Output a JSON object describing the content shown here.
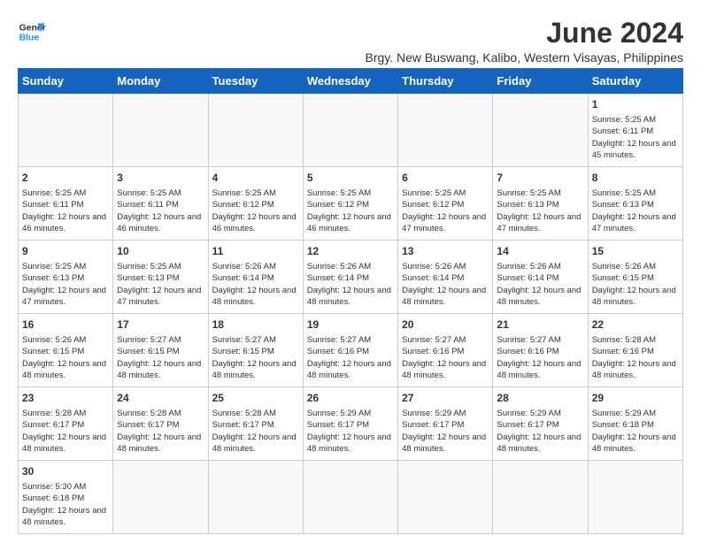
{
  "logo": {
    "line1": "General",
    "line2": "Blue"
  },
  "title": "June 2024",
  "subtitle": "Brgy. New Buswang, Kalibo, Western Visayas, Philippines",
  "days_of_week": [
    "Sunday",
    "Monday",
    "Tuesday",
    "Wednesday",
    "Thursday",
    "Friday",
    "Saturday"
  ],
  "weeks": [
    [
      {
        "day": "",
        "empty": true
      },
      {
        "day": "",
        "empty": true
      },
      {
        "day": "",
        "empty": true
      },
      {
        "day": "",
        "empty": true
      },
      {
        "day": "",
        "empty": true
      },
      {
        "day": "",
        "empty": true
      },
      {
        "day": "1",
        "sunrise": "5:25 AM",
        "sunset": "6:11 PM",
        "daylight": "12 hours and 45 minutes."
      }
    ],
    [
      {
        "day": "2",
        "sunrise": "5:25 AM",
        "sunset": "6:11 PM",
        "daylight": "12 hours and 46 minutes."
      },
      {
        "day": "3",
        "sunrise": "5:25 AM",
        "sunset": "6:11 PM",
        "daylight": "12 hours and 46 minutes."
      },
      {
        "day": "4",
        "sunrise": "5:25 AM",
        "sunset": "6:12 PM",
        "daylight": "12 hours and 46 minutes."
      },
      {
        "day": "5",
        "sunrise": "5:25 AM",
        "sunset": "6:12 PM",
        "daylight": "12 hours and 46 minutes."
      },
      {
        "day": "6",
        "sunrise": "5:25 AM",
        "sunset": "6:12 PM",
        "daylight": "12 hours and 47 minutes."
      },
      {
        "day": "7",
        "sunrise": "5:25 AM",
        "sunset": "6:13 PM",
        "daylight": "12 hours and 47 minutes."
      },
      {
        "day": "8",
        "sunrise": "5:25 AM",
        "sunset": "6:13 PM",
        "daylight": "12 hours and 47 minutes."
      }
    ],
    [
      {
        "day": "9",
        "sunrise": "5:25 AM",
        "sunset": "6:13 PM",
        "daylight": "12 hours and 47 minutes."
      },
      {
        "day": "10",
        "sunrise": "5:25 AM",
        "sunset": "6:13 PM",
        "daylight": "12 hours and 47 minutes."
      },
      {
        "day": "11",
        "sunrise": "5:26 AM",
        "sunset": "6:14 PM",
        "daylight": "12 hours and 48 minutes."
      },
      {
        "day": "12",
        "sunrise": "5:26 AM",
        "sunset": "6:14 PM",
        "daylight": "12 hours and 48 minutes."
      },
      {
        "day": "13",
        "sunrise": "5:26 AM",
        "sunset": "6:14 PM",
        "daylight": "12 hours and 48 minutes."
      },
      {
        "day": "14",
        "sunrise": "5:26 AM",
        "sunset": "6:14 PM",
        "daylight": "12 hours and 48 minutes."
      },
      {
        "day": "15",
        "sunrise": "5:26 AM",
        "sunset": "6:15 PM",
        "daylight": "12 hours and 48 minutes."
      }
    ],
    [
      {
        "day": "16",
        "sunrise": "5:26 AM",
        "sunset": "6:15 PM",
        "daylight": "12 hours and 48 minutes."
      },
      {
        "day": "17",
        "sunrise": "5:27 AM",
        "sunset": "6:15 PM",
        "daylight": "12 hours and 48 minutes."
      },
      {
        "day": "18",
        "sunrise": "5:27 AM",
        "sunset": "6:15 PM",
        "daylight": "12 hours and 48 minutes."
      },
      {
        "day": "19",
        "sunrise": "5:27 AM",
        "sunset": "6:16 PM",
        "daylight": "12 hours and 48 minutes."
      },
      {
        "day": "20",
        "sunrise": "5:27 AM",
        "sunset": "6:16 PM",
        "daylight": "12 hours and 48 minutes."
      },
      {
        "day": "21",
        "sunrise": "5:27 AM",
        "sunset": "6:16 PM",
        "daylight": "12 hours and 48 minutes."
      },
      {
        "day": "22",
        "sunrise": "5:28 AM",
        "sunset": "6:16 PM",
        "daylight": "12 hours and 48 minutes."
      }
    ],
    [
      {
        "day": "23",
        "sunrise": "5:28 AM",
        "sunset": "6:17 PM",
        "daylight": "12 hours and 48 minutes."
      },
      {
        "day": "24",
        "sunrise": "5:28 AM",
        "sunset": "6:17 PM",
        "daylight": "12 hours and 48 minutes."
      },
      {
        "day": "25",
        "sunrise": "5:28 AM",
        "sunset": "6:17 PM",
        "daylight": "12 hours and 48 minutes."
      },
      {
        "day": "26",
        "sunrise": "5:29 AM",
        "sunset": "6:17 PM",
        "daylight": "12 hours and 48 minutes."
      },
      {
        "day": "27",
        "sunrise": "5:29 AM",
        "sunset": "6:17 PM",
        "daylight": "12 hours and 48 minutes."
      },
      {
        "day": "28",
        "sunrise": "5:29 AM",
        "sunset": "6:17 PM",
        "daylight": "12 hours and 48 minutes."
      },
      {
        "day": "29",
        "sunrise": "5:29 AM",
        "sunset": "6:18 PM",
        "daylight": "12 hours and 48 minutes."
      }
    ],
    [
      {
        "day": "30",
        "sunrise": "5:30 AM",
        "sunset": "6:18 PM",
        "daylight": "12 hours and 48 minutes."
      },
      {
        "day": "",
        "empty": true
      },
      {
        "day": "",
        "empty": true
      },
      {
        "day": "",
        "empty": true
      },
      {
        "day": "",
        "empty": true
      },
      {
        "day": "",
        "empty": true
      },
      {
        "day": "",
        "empty": true
      }
    ]
  ]
}
